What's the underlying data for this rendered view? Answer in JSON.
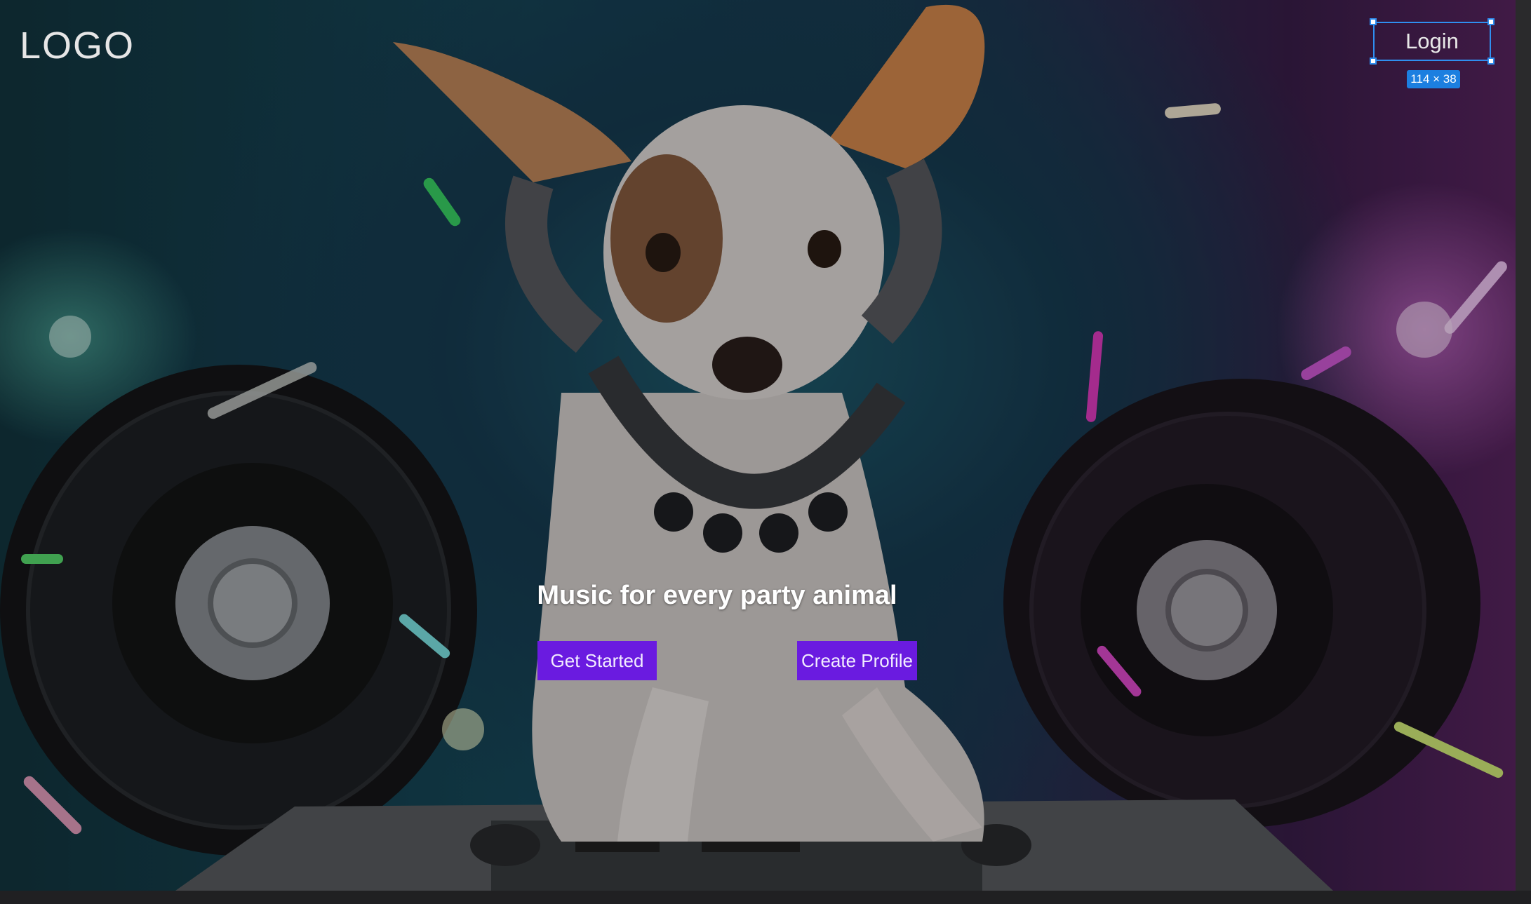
{
  "header": {
    "logo_text": "LOGO",
    "login_label": "Login"
  },
  "selection_overlay": {
    "size_label": "114 × 38"
  },
  "hero": {
    "headline": "Music for every party animal",
    "primary_cta_label": "Get Started",
    "secondary_cta_label": "Create Profile",
    "background_image": "dj-dog-with-headphones-and-turntables"
  },
  "colors": {
    "cta_background": "#6a1be0",
    "selection_accent": "#2f8ff0",
    "badge_background": "#1c7fe0"
  }
}
